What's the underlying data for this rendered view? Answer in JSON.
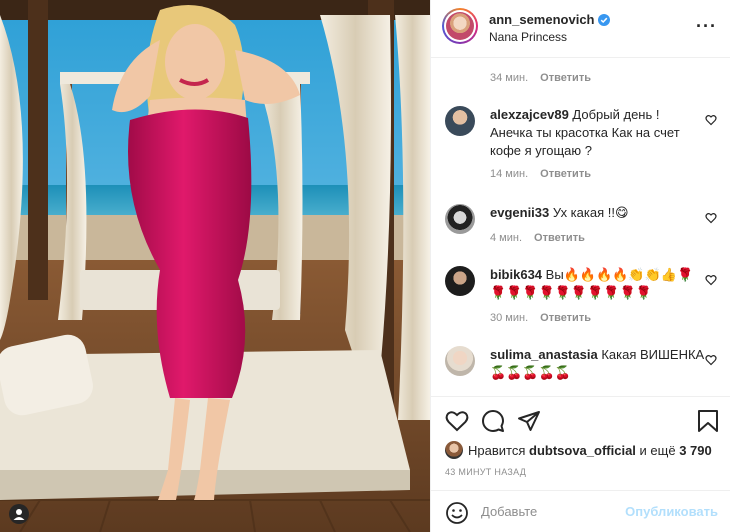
{
  "header": {
    "username": "ann_semenovich",
    "location": "Nana Princess",
    "more_label": "···"
  },
  "top_meta": {
    "time": "34 мин.",
    "reply": "Ответить"
  },
  "comments": [
    {
      "user": "alexzajcev89",
      "text": "Добрый день ! Анечка ты красотка Как на счет кофе я угощаю ?",
      "time": "14 мин.",
      "reply": "Ответить"
    },
    {
      "user": "evgenii33",
      "text": "Ух какая !!😋",
      "time": "4 мин.",
      "reply": "Ответить"
    },
    {
      "user": "bibik634",
      "text": "Вы🔥🔥🔥🔥👏👏👍🌹🌹🌹🌹🌹🌹🌹🌹🌹🌹🌹",
      "time": "30 мин.",
      "reply": "Ответить"
    },
    {
      "user": "sulima_anastasia",
      "text": "Какая ВИШЕНКА🍒🍒🍒🍒🍒",
      "time": "",
      "reply": ""
    }
  ],
  "likes": {
    "prefix": "Нравится",
    "user": "dubtsova_official",
    "middle": "и ещё",
    "count": "3 790"
  },
  "time_ago": "43 МИНУТ НАЗАД",
  "add_comment": {
    "placeholder": "Добавьте комментарий...",
    "shown_text": "Добавьте",
    "publish": "Опубликовать"
  },
  "colors": {
    "accent": "#0095f6",
    "publish_disabled": "#b2dffc",
    "verified": "#3897f0",
    "dress": "#d1135c",
    "meta": "#8e8e8e"
  },
  "icons": [
    "verified-icon",
    "more-icon",
    "heart-icon",
    "comment-icon",
    "share-icon",
    "bookmark-icon",
    "smile-icon",
    "threads-icon"
  ]
}
